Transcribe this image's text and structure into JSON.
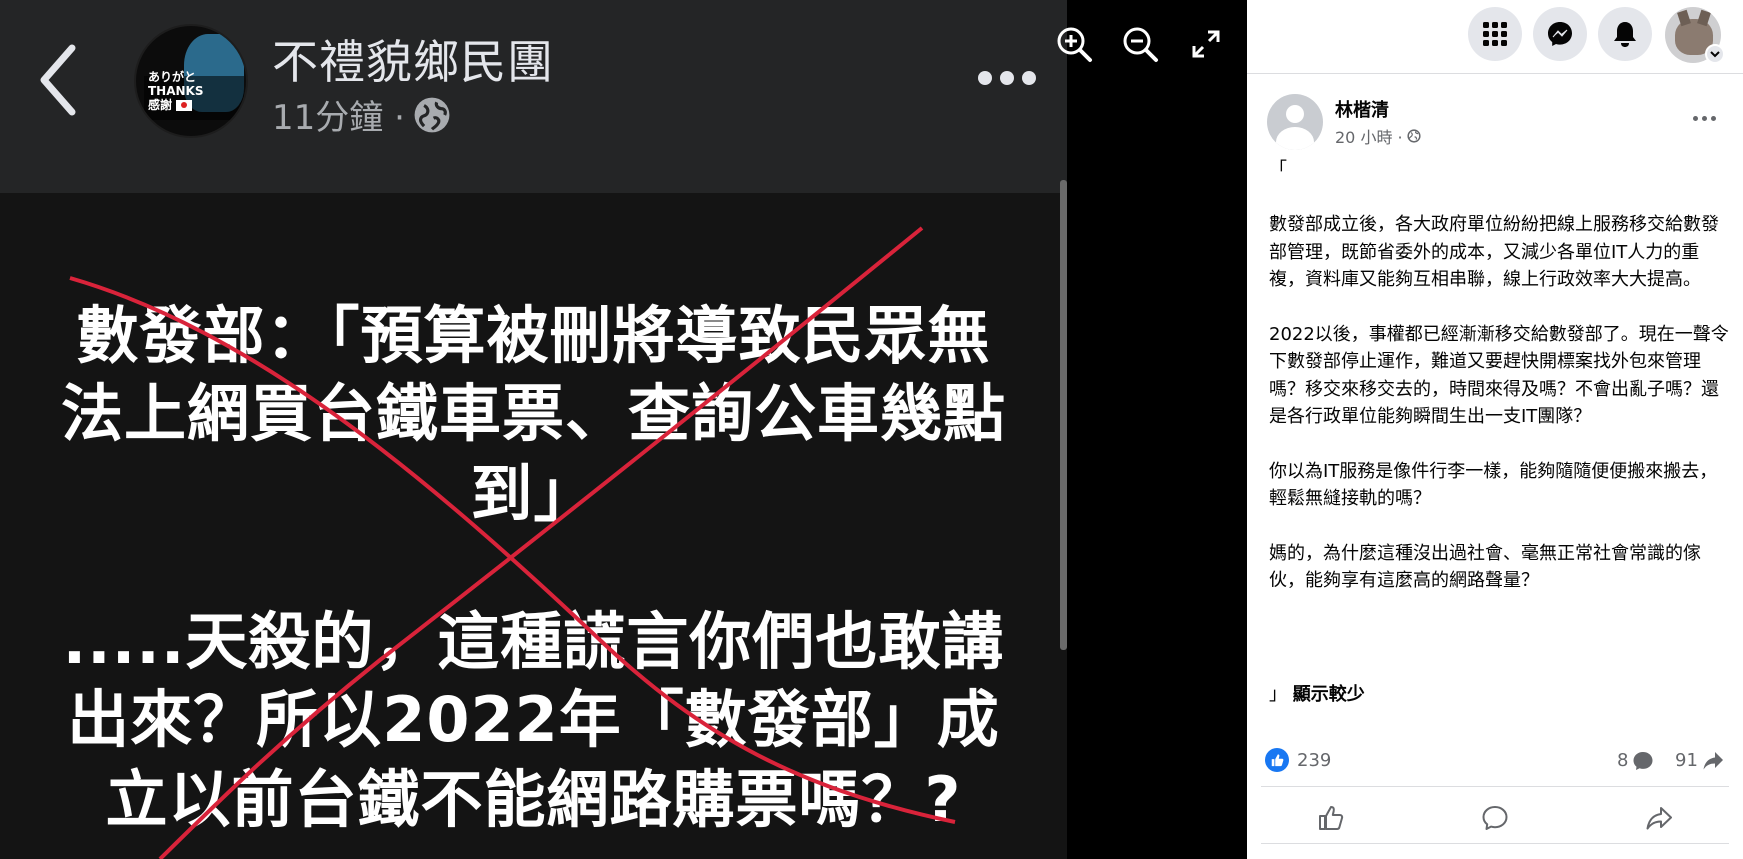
{
  "viewer": {
    "page_name": "不禮貌鄉民團",
    "time_ago": "11分鐘 ·",
    "avatar_text_line1": "ありがと",
    "avatar_text_line2": "THANKS",
    "avatar_text_line3": "感謝",
    "photo_lines": [
      "數發部：「預算被刪將導致民眾無",
      "法上網買台鐵車票、查詢公車幾點",
      "到」",
      ".....天殺的，這種謊言你們也敢講",
      "出來？所以2022年「數發部」成",
      "立以前台鐵不能網路購票嗎？?"
    ],
    "cross_color": "#d9233a",
    "tools": [
      "zoom-in-icon",
      "zoom-out-icon",
      "fullscreen-icon"
    ]
  },
  "topnav": {
    "icons": [
      "menu-grid-icon",
      "messenger-icon",
      "bell-icon"
    ]
  },
  "post": {
    "author": "林楷清",
    "time": "20 小時 ·",
    "open_bracket": "「",
    "paragraphs": [
      "數發部成立後，各大政府單位紛紛把線上服務移交給數發部管理，既節省委外的成本，又減少各單位IT人力的重複，資料庫又能夠互相串聯，線上行政效率大大提高。",
      "2022以後，事權都已經漸漸移交給數發部了。現在一聲令下數發部停止運作，難道又要趕快開標案找外包來管理嗎？移交來移交去的，時間來得及嗎？不會出亂子嗎？還是各行政單位能夠瞬間生出一支IT團隊？",
      "你以為IT服務是像件行李一樣，能夠隨隨便便搬來搬去，輕鬆無縫接軌的嗎？",
      "媽的，為什麼這種沒出過社會、毫無正常社會常識的傢伙，能夠享有這麼高的網路聲量？"
    ],
    "close_bracket": "」",
    "see_less": "顯示較少",
    "reaction_count": "239",
    "comment_count": "8",
    "share_count": "91"
  },
  "colors": {
    "accent": "#1877f2",
    "panel_bg": "#ffffff",
    "viewer_bg": "#000000"
  }
}
